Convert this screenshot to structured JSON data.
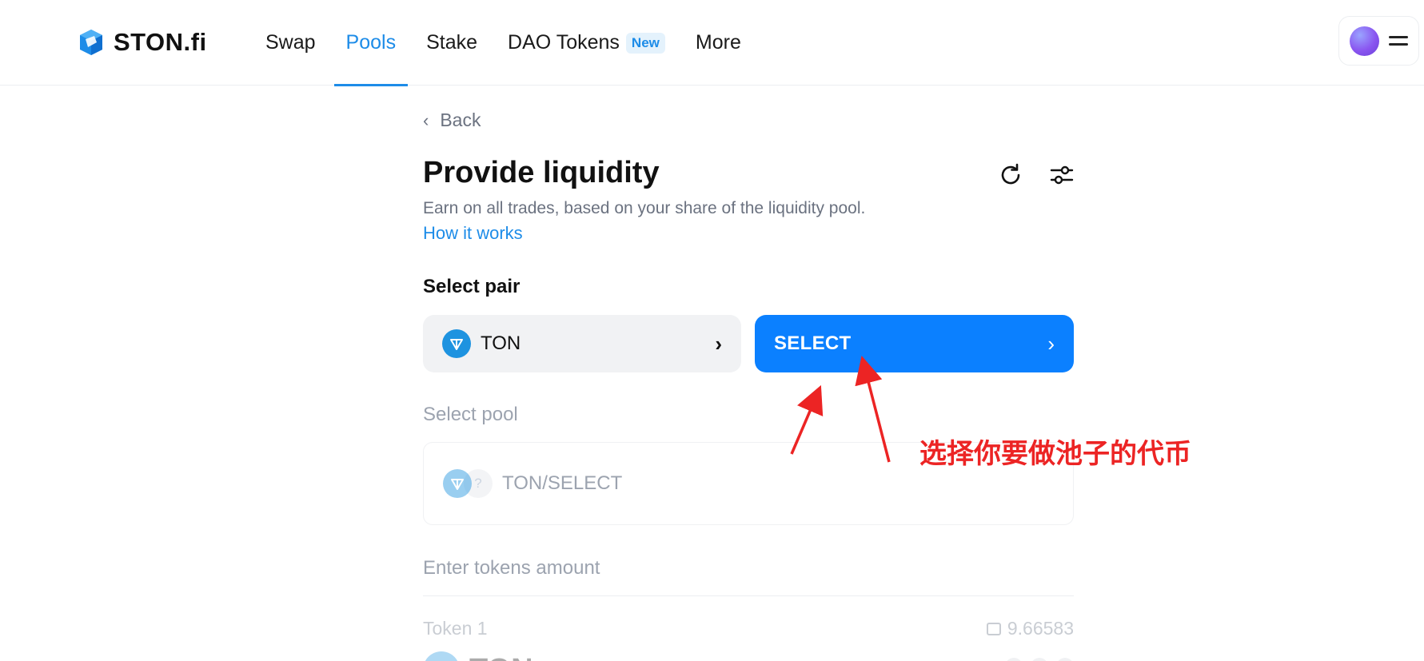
{
  "header": {
    "logo_text": "STON.fi",
    "nav": [
      {
        "label": "Swap",
        "active": false
      },
      {
        "label": "Pools",
        "active": true
      },
      {
        "label": "Stake",
        "active": false
      },
      {
        "label": "DAO Tokens",
        "active": false,
        "badge": "New"
      },
      {
        "label": "More",
        "active": false
      }
    ],
    "icons": {
      "logo": "ston-logo-icon",
      "avatar": "avatar",
      "menu": "hamburger-icon"
    }
  },
  "page": {
    "back_label": "Back",
    "title": "Provide liquidity",
    "subtitle": "Earn on all trades, based on your share of the liquidity pool.",
    "how_link": "How it works",
    "select_pair_label": "Select pair",
    "token_a": "TON",
    "select_label": "SELECT",
    "select_pool_label": "Select pool",
    "pool_name": "TON/SELECT",
    "pool_placeholder_icon": "?",
    "enter_amount_label": "Enter tokens amount",
    "token1_label": "Token 1",
    "token1_balance": "9.66583",
    "token1_symbol": "TON"
  },
  "annotation": {
    "text": "选择你要做池子的代币",
    "color": "#ec2424"
  },
  "colors": {
    "accent": "#1d8ce8",
    "primary_button": "#0b80ff",
    "ton_blue": "#1e93e0"
  }
}
